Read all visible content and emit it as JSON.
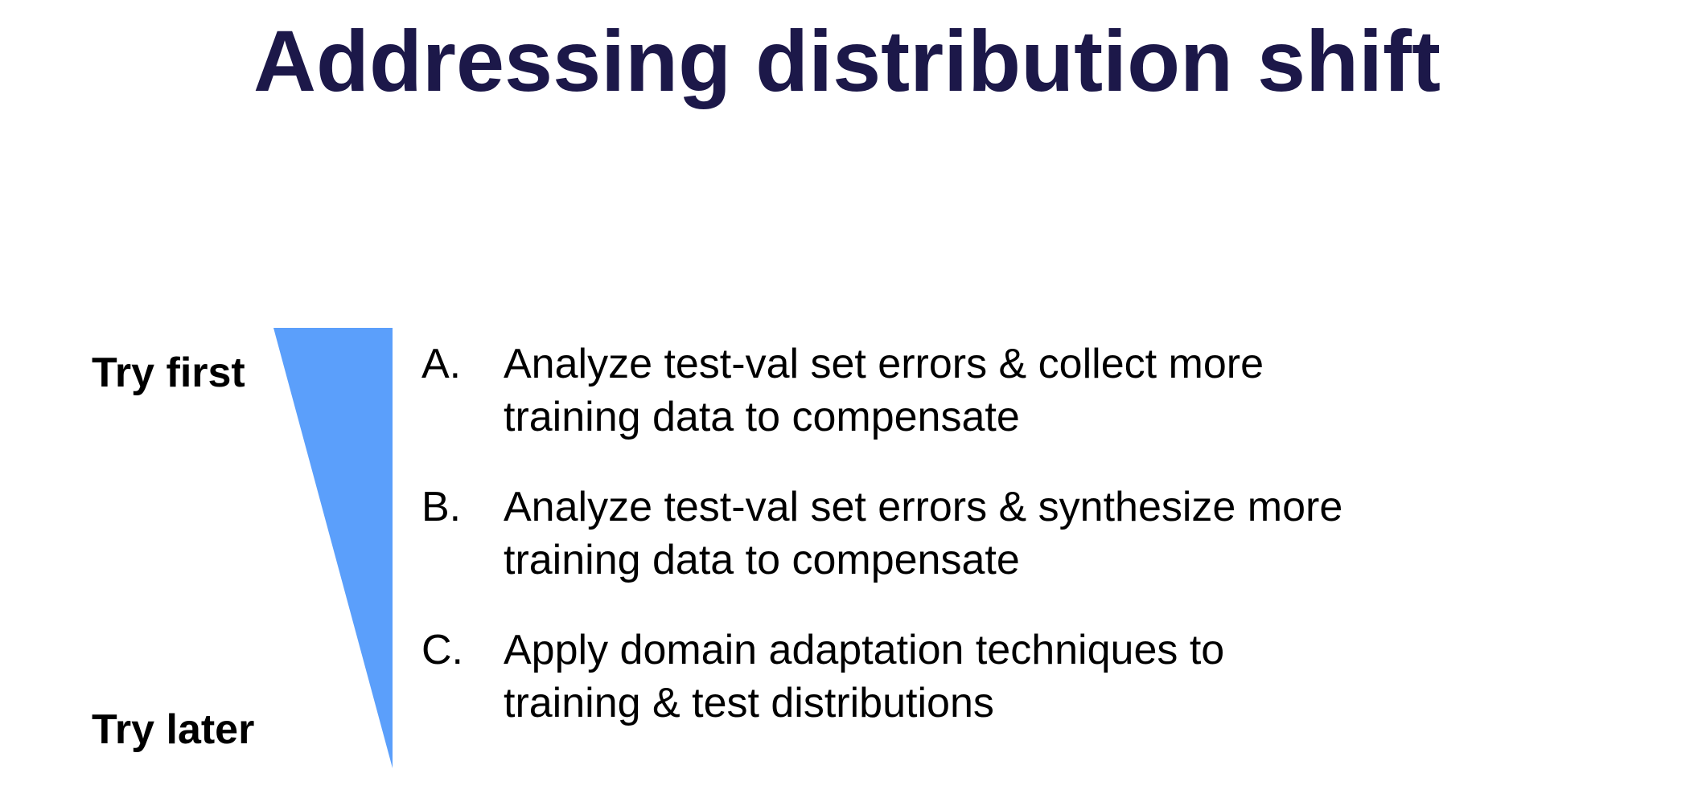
{
  "slide": {
    "title": "Addressing distribution shift",
    "labels": {
      "first": "Try first",
      "later": "Try later"
    },
    "wedge_color": "#5b9ffb",
    "options": [
      {
        "letter": "A.",
        "lines": [
          "Analyze test-val set errors & collect more",
          "training data to compensate"
        ]
      },
      {
        "letter": "B.",
        "lines": [
          "Analyze test-val set errors & synthesize more",
          "training data to compensate"
        ]
      },
      {
        "letter": "C.",
        "lines": [
          "Apply domain adaptation techniques to",
          "training & test distributions"
        ]
      }
    ]
  }
}
